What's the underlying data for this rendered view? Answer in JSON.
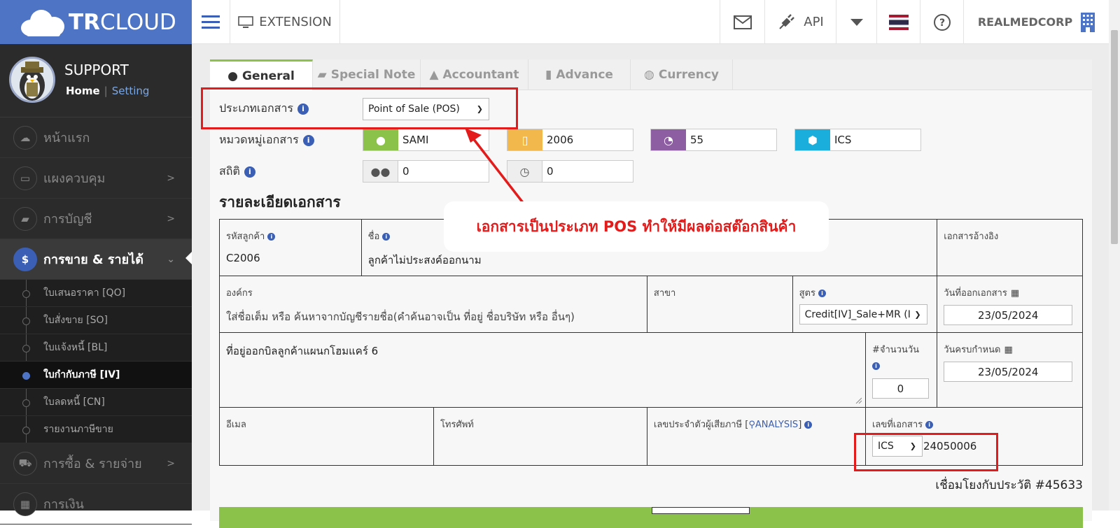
{
  "logo": {
    "bold": "TR",
    "rest": "CLOUD"
  },
  "topbar": {
    "extension_label": "EXTENSION",
    "api_label": "API",
    "company": "REALMEDCORP"
  },
  "sidebar": {
    "user_name": "SUPPORT",
    "home_link": "Home",
    "setting_link": "Setting",
    "items": [
      {
        "label": "หน้าแรก",
        "icon": "cloud-icon"
      },
      {
        "label": "แผงควบคุม",
        "icon": "monitor-icon"
      },
      {
        "label": "การบัญชี",
        "icon": "book-icon"
      },
      {
        "label": "การขาย & รายได้",
        "icon": "dollar-icon"
      },
      {
        "label": "การซื้อ & รายจ่าย",
        "icon": "cart-icon"
      },
      {
        "label": "การเงิน",
        "icon": "calendar-icon"
      }
    ],
    "subitems": [
      "ใบเสนอราคา [QO]",
      "ใบสั่งขาย [SO]",
      "ใบแจ้งหนี้ [BL]",
      "ใบกำกับภาษี [IV]",
      "ใบลดหนี้ [CN]",
      "รายงานภาษีขาย"
    ]
  },
  "tabs": [
    "General",
    "Special Note",
    "Accountant",
    "Advance",
    "Currency"
  ],
  "form": {
    "doc_type_label": "ประเภทเอกสาร",
    "doc_type_value": "Point of Sale (POS)",
    "category_label": "หมวดหมู่เอกสาร",
    "category_values": [
      "SAMI",
      "2006",
      "55",
      "ICS"
    ],
    "stats_label": "สถิติ",
    "stats_values": [
      "0",
      "0"
    ]
  },
  "section_title": "รายละเอียดเอกสาร",
  "details": {
    "customer_code_label": "รหัสลูกค้า",
    "customer_code": "C2006",
    "name_label": "ชื่อ",
    "name_value": "ลูกค้าไม่ประสงค์ออกนาม",
    "ref_doc_label": "เอกสารอ้างอิง",
    "org_label": "องค์กร",
    "org_value": "ใส่ชื่อเต็ม หรือ ค้นหาจากบัญชีรายชื่อ(คำค้นอาจเป็น ที่อยู่ ชื่อบริษัท หรือ อื่นๆ)",
    "branch_label": "สาขา",
    "formula_label": "สูตร",
    "formula_value": "Credit[IV]_Sale+MR (I",
    "issue_date_label": "วันที่ออกเอกสาร",
    "issue_date": "23/05/2024",
    "address_value": "ที่อยู่ออกบิลลูกค้าแผนกโฮมแคร์ 6",
    "days_label": "#จำนวนวัน",
    "days_value": "0",
    "due_date_label": "วันครบกำหนด",
    "due_date": "23/05/2024",
    "email_label": "อีเมล",
    "phone_label": "โทรศัพท์",
    "taxid_label": "เลขประจำตัวผู้เสียภาษี [",
    "analysis_label": "ANALYSIS",
    "taxid_close": "]",
    "docno_label": "เลขที่เอกสาร",
    "docno_prefix": "ICS",
    "docno_value": "24050006",
    "history_link": "เชื่อมโยงกับประวัติ #45633"
  },
  "callout_text": "เอกสารเป็นประเภท POS ทำให้มีผลต่อสต๊อกสินค้า",
  "colors": {
    "header_blue": "#4e74c5",
    "highlight_red": "#e31b1b",
    "green": "#8bc34a"
  }
}
